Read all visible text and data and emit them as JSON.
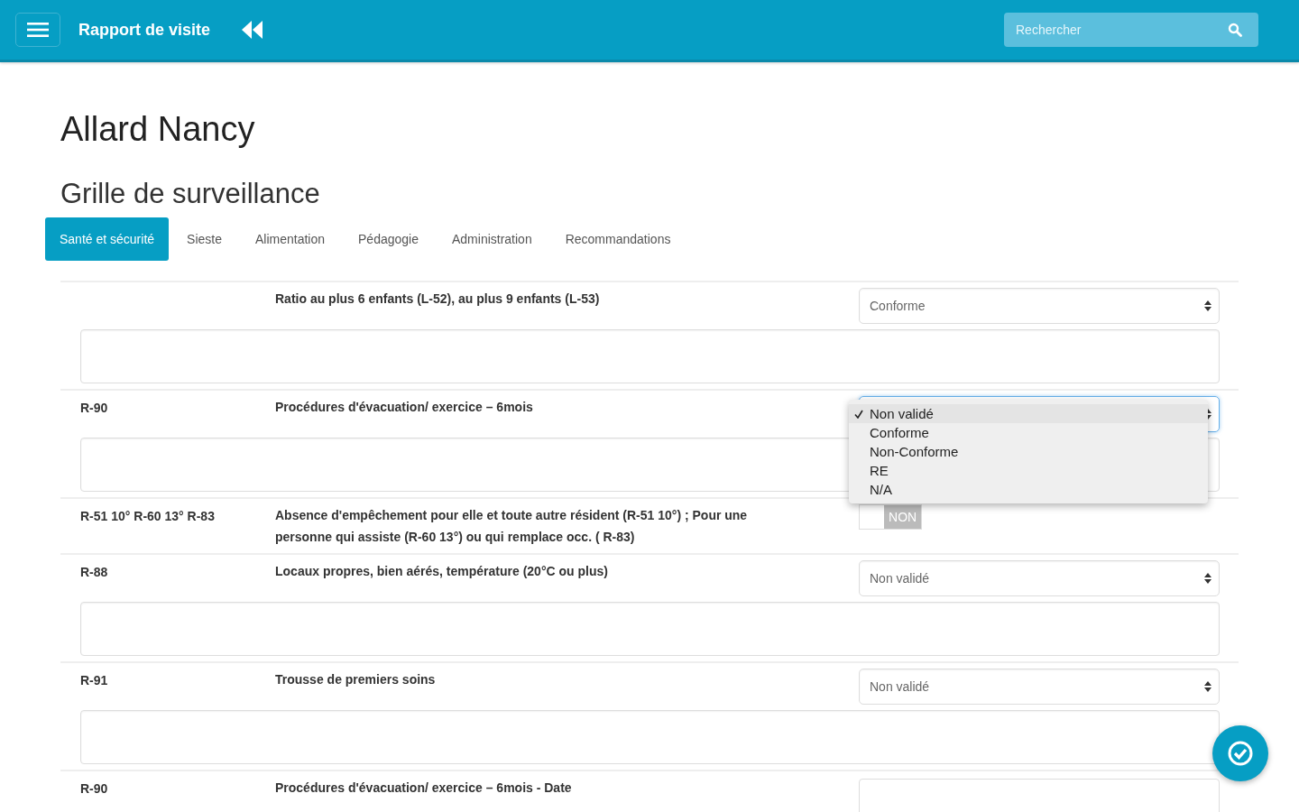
{
  "header": {
    "title": "Rapport de visite",
    "search": {
      "placeholder": "Rechercher"
    }
  },
  "page_title": "Allard Nancy",
  "section_title": "Grille de surveillance",
  "tabs": [
    {
      "label": "Santé et sécurité",
      "selected": true
    },
    {
      "label": "Sieste",
      "selected": false
    },
    {
      "label": "Alimentation",
      "selected": false
    },
    {
      "label": "Pédagogie",
      "selected": false
    },
    {
      "label": "Administration",
      "selected": false
    },
    {
      "label": "Recommandations",
      "selected": false
    }
  ],
  "rows": [
    {
      "kind": "select",
      "label": "Ratio au plus 6 enfants (L-52), au plus 9 enfants (L-53)",
      "value": "Conforme",
      "focused": false
    },
    {
      "kind": "select",
      "code": "R-90",
      "label": "Procédures d'évacuation/ exercice – 6mois",
      "focused": true,
      "dropdown": {
        "options": [
          {
            "label": "Non validé",
            "selected": true
          },
          {
            "label": "Conforme",
            "selected": false
          },
          {
            "label": "Non-Conforme",
            "selected": false
          },
          {
            "label": "RE",
            "selected": false
          },
          {
            "label": "N/A",
            "selected": false
          }
        ]
      }
    },
    {
      "kind": "toggle",
      "code": "R-51 10° R-60 13° R-83",
      "label": "Absence d'empêchement pour elle et toute autre résident (R-51 10°) ; Pour une personne qui assiste (R-60 13°) ou qui remplace occ. ( R-83)",
      "on": false,
      "toggle_label": "NON"
    },
    {
      "kind": "select",
      "code": "R-88",
      "label": "Locaux propres, bien aérés, température (20°C ou plus)",
      "value": "Non validé",
      "focused": false
    },
    {
      "kind": "select",
      "code": "R-91",
      "label": "Trousse de premiers soins",
      "value": "Non validé",
      "focused": false
    },
    {
      "kind": "date",
      "code": "R-90",
      "label": "Procédures d'évacuation/ exercice – 6mois - Date"
    }
  ]
}
